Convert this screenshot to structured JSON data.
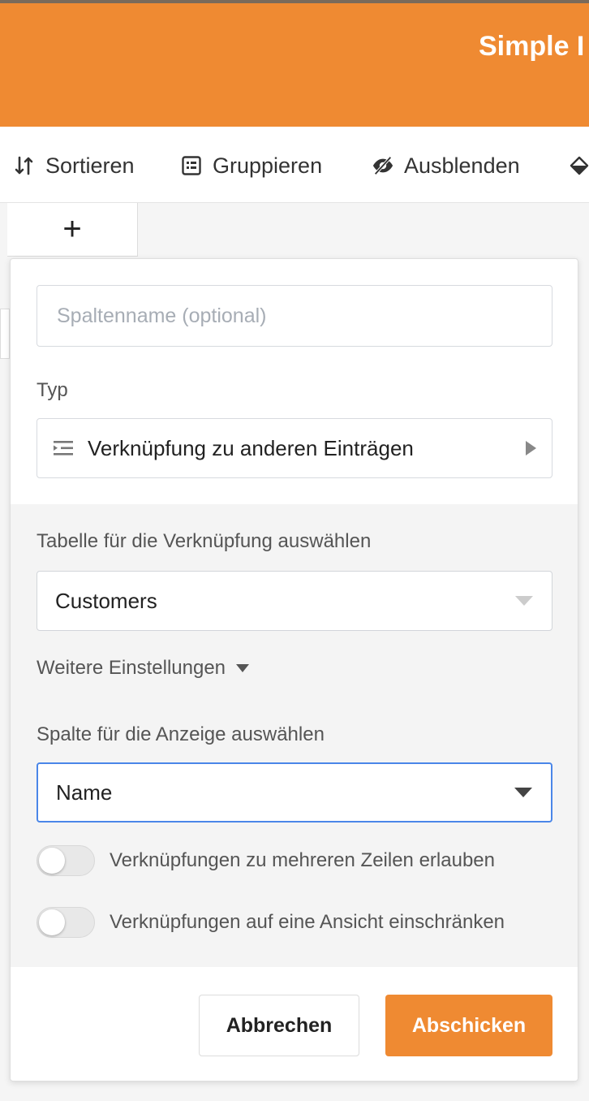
{
  "app": {
    "title": "Simple I"
  },
  "toolbar": {
    "sort_label": "Sortieren",
    "group_label": "Gruppieren",
    "hide_label": "Ausblenden"
  },
  "grid": {
    "add_column_symbol": "+"
  },
  "dialog": {
    "name_placeholder": "Spaltenname (optional)",
    "type_label": "Typ",
    "type_value": "Verknüpfung zu anderen Einträgen",
    "table_label": "Tabelle für die Verknüpfung auswählen",
    "table_value": "Customers",
    "more_settings_label": "Weitere Einstellungen",
    "display_column_label": "Spalte für die Anzeige auswählen",
    "display_column_value": "Name",
    "toggle_multiple_label": "Verknüpfungen zu mehreren Zeilen erlauben",
    "toggle_view_label": "Verknüpfungen auf eine Ansicht einschränken",
    "cancel_label": "Abbrechen",
    "submit_label": "Abschicken"
  },
  "colors": {
    "brand": "#ef8a32",
    "focus": "#4a86e8"
  }
}
